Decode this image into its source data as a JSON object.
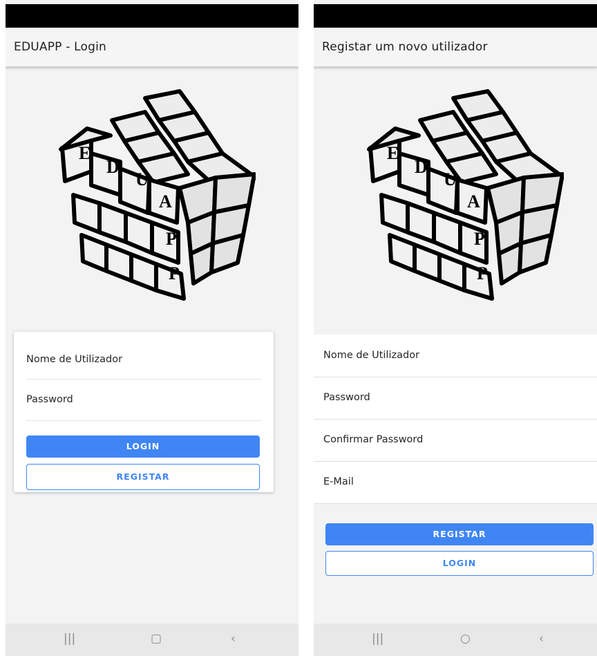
{
  "login_screen": {
    "title": "EDUAPP - Login",
    "fields": {
      "username_label": "Nome de Utilizador",
      "password_label": "Password"
    },
    "buttons": {
      "login_label": "LOGIN",
      "register_label": "REGISTAR"
    }
  },
  "register_screen": {
    "title": "Registar um novo utilizador",
    "fields": {
      "username_label": "Nome de Utilizador",
      "password_label": "Password",
      "confirm_password_label": "Confirmar Password",
      "email_label": "E-Mail"
    },
    "buttons": {
      "register_label": "REGISTAR",
      "login_label": "LOGIN"
    }
  },
  "logo": {
    "letters": [
      "E",
      "D",
      "U",
      "A",
      "P",
      "P"
    ]
  },
  "nav": {
    "recents_icon": "recents-icon",
    "home_icon": "home-icon",
    "back_icon": "back-icon"
  },
  "colors": {
    "accent": "#3f86f4",
    "status_bar": "#000000",
    "background": "#f3f3f3",
    "nav_bar": "#e8e8e8"
  }
}
